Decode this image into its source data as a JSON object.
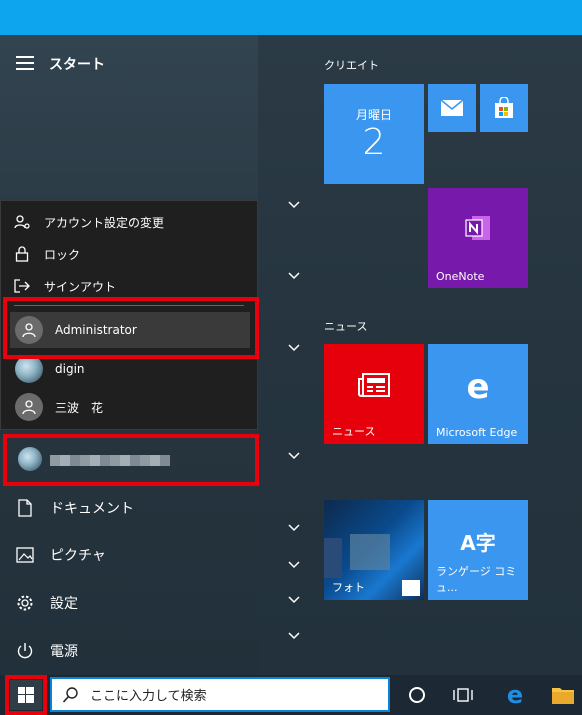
{
  "start": {
    "title": "スタート"
  },
  "account_menu": {
    "change_settings": "アカウント設定の変更",
    "lock": "ロック",
    "sign_out": "サインアウト"
  },
  "accounts": [
    {
      "name": "Administrator",
      "selected": true
    },
    {
      "name": "digin",
      "selected": false
    },
    {
      "name": "三波　花",
      "selected": false
    }
  ],
  "sidebar": {
    "documents": "ドキュメント",
    "pictures": "ピクチャ",
    "settings": "設定",
    "power": "電源"
  },
  "groups": {
    "create": "クリエイト",
    "news": "ニュース"
  },
  "tiles": {
    "calendar_day": "月曜日",
    "calendar_date": "2",
    "onenote": "OneNote",
    "news": "ニュース",
    "edge": "Microsoft Edge",
    "photos": "フォト",
    "language": "ランゲージ コミュ..."
  },
  "taskbar": {
    "search_placeholder": "ここに入力して検索"
  },
  "colors": {
    "tile_blue": "#3a96ef",
    "onenote_purple": "#7719aa",
    "news_red": "#e5000b",
    "highlight_red": "#e8000d"
  }
}
